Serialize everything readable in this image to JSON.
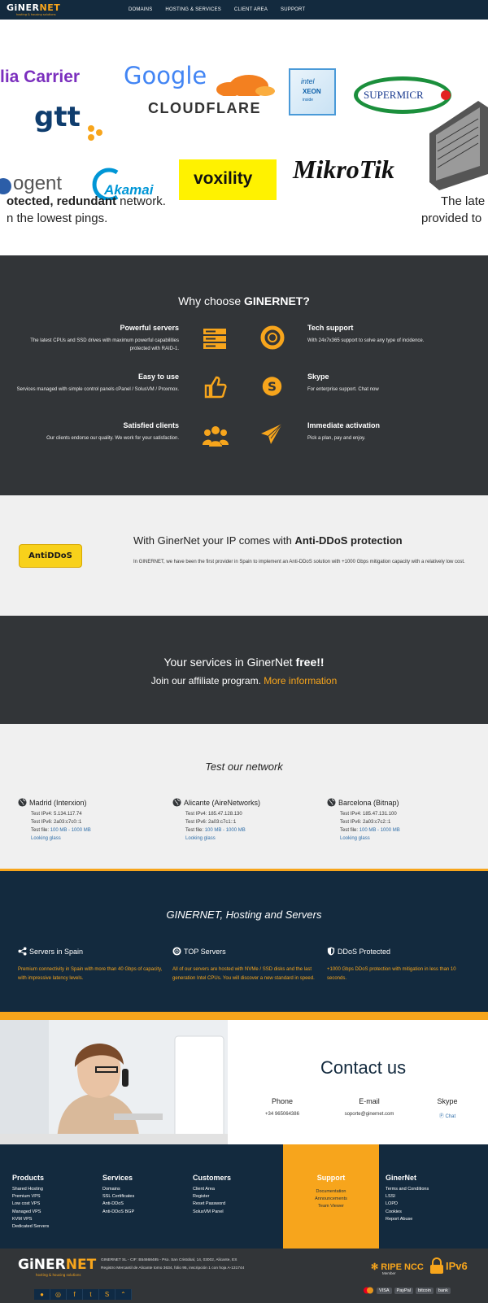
{
  "header": {
    "logo_g": "G",
    "logo_iner": "iNER",
    "logo_net": "NET",
    "logo_tagline": "hosting & housing solutions",
    "nav": [
      "DOMAINS",
      "HOSTING & SERVICES",
      "CLIENT AREA",
      "SUPPORT"
    ]
  },
  "slider": {
    "logos": {
      "carrier": "lia Carrier",
      "google": "Google",
      "cloudflare": "CLOUDFLARE",
      "intel_1": "intel",
      "intel_2": "XEON",
      "intel_3": "inside",
      "supermicro": "SUPERMICR",
      "gtt": "gtt",
      "cogent": "ogent",
      "akamai": "Akamai",
      "voxility": "voxility",
      "mikrotik": "MikroTik"
    },
    "caption_left_1a": "otected, redundant",
    "caption_left_1b": " network.",
    "caption_left_2": "n the lowest pings.",
    "caption_right_1": "The late",
    "caption_right_2": "provided to"
  },
  "why": {
    "title_a": "Why choose ",
    "title_b": "GINERNET?",
    "items": [
      {
        "title": "Powerful servers",
        "desc1": "The latest CPUs and SSD drives with maximum powerful capabilities",
        "desc2": "protected with RAID-1."
      },
      {
        "title": "Easy to use",
        "desc1": "Services managed with simple control panels cPanel / SolusVM / Proxmox.",
        "desc2": ""
      },
      {
        "title": "Satisfied clients",
        "desc1": "Our clients endorse our quality. We work for your satisfaction.",
        "desc2": ""
      },
      {
        "title": "Tech support",
        "desc1": "With 24x7x365 support to solve any type of incidence.",
        "desc2": ""
      },
      {
        "title": "Skype",
        "desc1": "For enterprise support. Chat now",
        "desc2": ""
      },
      {
        "title": "Immediate activation",
        "desc1": "Pick a plan, pay and enjoy.",
        "desc2": ""
      }
    ]
  },
  "ddos": {
    "badge": "AntiDDoS",
    "title_a": "With GinerNet your IP comes with ",
    "title_b": "Anti-DDoS protection",
    "text": "In GINERNET, we have been the first provider in Spain to implement an Anti-DDoS solution with +1000 Gbps mitigation capacity with a relatively low cost."
  },
  "affiliate": {
    "line1_a": "Your services in GinerNet ",
    "line1_b": "free!!",
    "line2_a": "Join our affiliate program. ",
    "line2_b": "More information"
  },
  "test": {
    "title": "Test our network",
    "locations": [
      {
        "name": "Madrid (Interxion)",
        "ipv4": "Test IPv4: 5.134.117.74",
        "ipv6": "Test IPv6: 2a03:c7c0::1",
        "file_label": "Test file: ",
        "file_link": "100 MB - 1000 MB",
        "glass": "Looking glass"
      },
      {
        "name": "Alicante (AireNetworks)",
        "ipv4": "Test IPv4: 185.47.128.130",
        "ipv6": "Test IPv6: 2a03:c7c1::1",
        "file_label": "Test file: ",
        "file_link": "100 MB - 1000 MB",
        "glass": "Looking glass"
      },
      {
        "name": "Barcelona (Bitnap)",
        "ipv4": "Test IPv4: 185.47.131.100",
        "ipv6": "Test IPv6: 2a03:c7c2::1",
        "file_label": "Test file: ",
        "file_link": "100 MB - 1000 MB",
        "glass": "Looking glass"
      }
    ]
  },
  "hosting": {
    "title": "GINERNET, Hosting and Servers",
    "cols": [
      {
        "title": "Servers in Spain",
        "d1": "Premium connectivity in Spain with more than 40 Gbps of capacity,",
        "d2": "with impressive latency levels."
      },
      {
        "title": "TOP Servers",
        "d1": "All of our servers are hosted with NVMe / SSD disks and the last",
        "d2": "generation Intel CPUs. You will discover a new standard in speed."
      },
      {
        "title": "DDoS Protected",
        "d1": "+1000 Gbps DDoS protection with mitigation in less than 10",
        "d2": "seconds."
      }
    ]
  },
  "contact": {
    "title": "Contact us",
    "phone_label": "Phone",
    "phone": "+34 965064386",
    "email_label": "E-mail",
    "email": "soporte@ginernet.com",
    "skype_label": "Skype",
    "skype": "Chat"
  },
  "footer": {
    "products": {
      "title": "Products",
      "items": [
        "Shared Hosting",
        "Premium VPS",
        "Low cost VPS",
        "Managed VPS",
        "KVM VPS",
        "Dedicated Servers"
      ]
    },
    "services": {
      "title": "Services",
      "items": [
        "Domains",
        "SSL Certificates",
        "Anti-DDoS",
        "Anti-DDoS BGP"
      ]
    },
    "customers": {
      "title": "Customers",
      "items": [
        "Client Area",
        "Register",
        "Reset Password",
        "SolusVM Panel"
      ]
    },
    "support": {
      "title": "Support",
      "items": [
        "Documentation",
        "Announcements",
        "Team Viewer"
      ]
    },
    "ginernet": {
      "title": "GinerNet",
      "items": [
        "Terms and Conditions",
        "LSSI",
        "LOPD",
        "Cookies",
        "Report Abuse"
      ]
    }
  },
  "bottom": {
    "legal1": "GINERNET SL - CIF: B54668485 - Pso. San Cristobal, 14, 03002, Alicante, ES",
    "legal2": "Registro Mercantil de Alicante tomo 3634, folio 95, inscripción 1 con hoja A-131744",
    "ripe": "RIPE NCC",
    "ripe_sub": "Member",
    "ipv6": "IPv6",
    "payments": [
      "VISA",
      "PayPal",
      "bitcoin",
      "bank"
    ]
  },
  "colors": {
    "navy": "#132a3e",
    "orange": "#f7a51c",
    "dark": "#323538",
    "light": "#f0f0f0"
  }
}
